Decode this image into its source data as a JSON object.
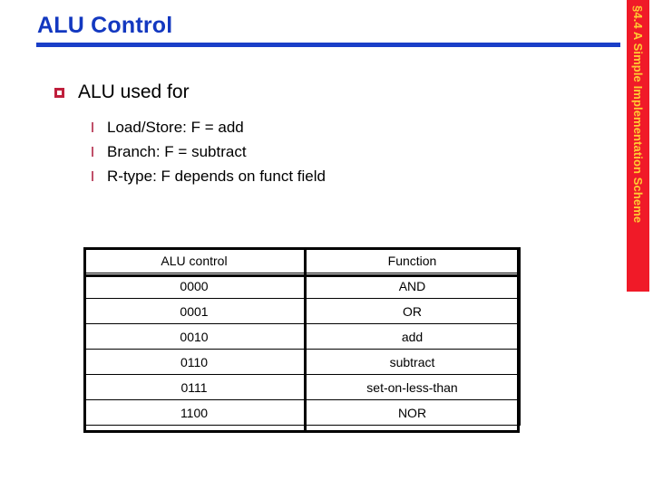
{
  "slide": {
    "title": "ALU Control",
    "sidebar_label": "§4.4 A Simple Implementation Scheme",
    "colors": {
      "title_blue": "#1338c0",
      "rule_blue": "#1a3fc8",
      "bullet_crimson": "#bf1f3c",
      "sidebar_red": "#f01a28",
      "sidebar_text": "#ffcc33",
      "table_border": "#000000",
      "background": "#ffffff"
    }
  },
  "bullets": {
    "level1": "ALU used for",
    "level2": [
      "Load/Store: F = add",
      "Branch: F = subtract",
      "R-type: F depends on funct field"
    ]
  },
  "table": {
    "headers": [
      "ALU control",
      "Function"
    ],
    "rows": [
      [
        "0000",
        "AND"
      ],
      [
        "0001",
        "OR"
      ],
      [
        "0010",
        "add"
      ],
      [
        "0110",
        "subtract"
      ],
      [
        "0111",
        "set-on-less-than"
      ],
      [
        "1100",
        "NOR"
      ]
    ]
  }
}
